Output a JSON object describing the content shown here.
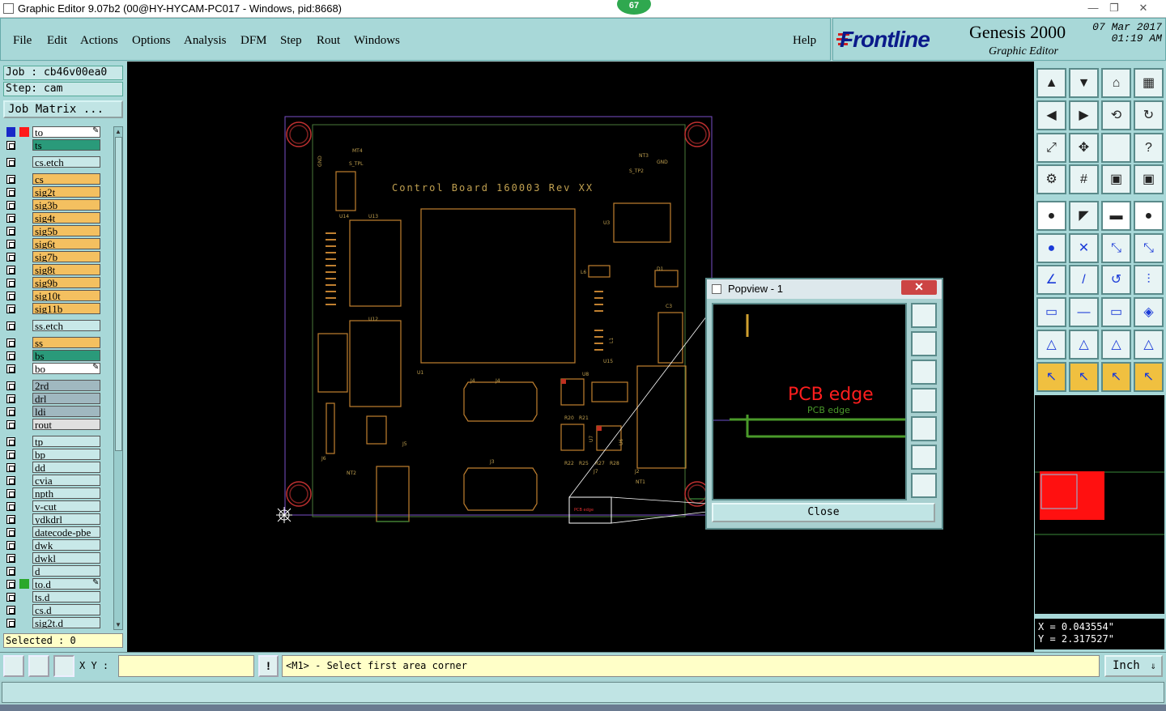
{
  "window": {
    "title": "Graphic Editor 9.07b2 (00@HY-HYCAM-PC017 - Windows, pid:8668)",
    "badge": "67",
    "minimize": "—",
    "restore": "❐",
    "close": "✕"
  },
  "menu": {
    "items": [
      "File",
      "Edit",
      "Actions",
      "Options",
      "Analysis",
      "DFM",
      "Step",
      "Rout",
      "Windows"
    ],
    "help": "Help"
  },
  "logo": {
    "brand": "Frontline",
    "product": "Genesis 2000",
    "subtitle": "Graphic Editor",
    "date": "07 Mar 2017",
    "time": "01:19 AM"
  },
  "left": {
    "job": "Job : cb46v00ea0",
    "step": "Step: cam",
    "job_matrix": "Job Matrix ...",
    "selected": "Selected : 0",
    "layers": [
      {
        "name": "to",
        "color": "#ffffff",
        "marker": "pencil"
      },
      {
        "name": "ts",
        "color": "#2a9a7a"
      },
      {
        "name": "cs.etch",
        "color": "#c8e8e8",
        "gap": true
      },
      {
        "name": "cs",
        "color": "#f4c060",
        "gap": true
      },
      {
        "name": "sig2t",
        "color": "#f4c060"
      },
      {
        "name": "sig3b",
        "color": "#f4c060"
      },
      {
        "name": "sig4t",
        "color": "#f4c060"
      },
      {
        "name": "sig5b",
        "color": "#f4c060"
      },
      {
        "name": "sig6t",
        "color": "#f4c060"
      },
      {
        "name": "sig7b",
        "color": "#f4c060"
      },
      {
        "name": "sig8t",
        "color": "#f4c060"
      },
      {
        "name": "sig9b",
        "color": "#f4c060"
      },
      {
        "name": "sig10t",
        "color": "#f4c060"
      },
      {
        "name": "sig11b",
        "color": "#f4c060"
      },
      {
        "name": "ss.etch",
        "color": "#c8e8e8",
        "gap": true
      },
      {
        "name": "ss",
        "color": "#f4c060",
        "gap": true
      },
      {
        "name": "bs",
        "color": "#2a9a7a"
      },
      {
        "name": "bo",
        "color": "#ffffff",
        "marker": "pencil"
      },
      {
        "name": "2rd",
        "color": "#a0b8c0",
        "gap": true
      },
      {
        "name": "drl",
        "color": "#a0b8c0"
      },
      {
        "name": "ldi",
        "color": "#a0b8c0"
      },
      {
        "name": "rout",
        "color": "#e0e0e0"
      },
      {
        "name": "tp",
        "color": "#c8e8e8",
        "gap": true
      },
      {
        "name": "bp",
        "color": "#c8e8e8"
      },
      {
        "name": "dd",
        "color": "#c8e8e8"
      },
      {
        "name": "cvia",
        "color": "#c8e8e8"
      },
      {
        "name": "npth",
        "color": "#c8e8e8"
      },
      {
        "name": "v-cut",
        "color": "#c8e8e8"
      },
      {
        "name": "ydkdrl",
        "color": "#c8e8e8"
      },
      {
        "name": "datecode-pbe",
        "color": "#c8e8e8"
      },
      {
        "name": "dwk",
        "color": "#c8e8e8"
      },
      {
        "name": "dwkl",
        "color": "#c8e8e8"
      },
      {
        "name": "d",
        "color": "#c8e8e8"
      },
      {
        "name": "to.d",
        "color": "#c8e8e8",
        "marker": "pencil"
      },
      {
        "name": "ts.d",
        "color": "#c8e8e8"
      },
      {
        "name": "cs.d",
        "color": "#c8e8e8"
      },
      {
        "name": "sig2t.d",
        "color": "#c8e8e8"
      }
    ]
  },
  "canvas": {
    "board_title": "Control Board 160003 Rev XX",
    "labels": [
      "MT4",
      "S_TPL",
      "NT3",
      "S_TP2",
      "GND",
      "GND",
      "U14",
      "U13",
      "U3",
      "U12",
      "U1",
      "U15",
      "U6",
      "U7",
      "U8",
      "D1",
      "C3",
      "J4",
      "J4",
      "J3",
      "J5",
      "J6",
      "J7",
      "J2",
      "NT2",
      "NT1",
      "R20",
      "R21",
      "R22",
      "R25",
      "R27",
      "R28",
      "L6",
      "L1"
    ]
  },
  "popview": {
    "title": "Popview - 1",
    "big_label": "PCB edge",
    "small_label": "PCB edge",
    "close": "Close"
  },
  "coords": {
    "x": "X = 0.043554\"",
    "y": "Y = 2.317527\""
  },
  "bottom": {
    "xy_label": "X Y :",
    "xy_value": "",
    "bang": "!",
    "prompt": "<M1> - Select first area corner",
    "units": "Inch"
  }
}
